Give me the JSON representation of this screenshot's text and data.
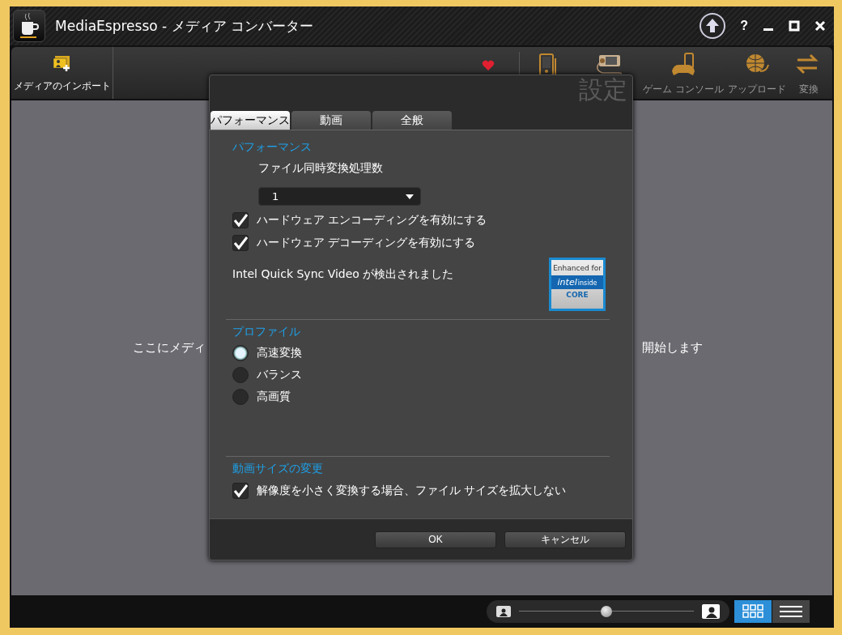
{
  "window": {
    "title": "MediaEspresso  - メディア コンバーター",
    "help": "?"
  },
  "toolbar": {
    "import_label": "メディアのインポート",
    "device_labels": [
      "ゲーム コンソール",
      "アップロード",
      "変換"
    ]
  },
  "drop_hint": {
    "left_part": "ここにメディ",
    "right_part": "開始します"
  },
  "dialog": {
    "title": "設定",
    "tabs": [
      {
        "label": "パフォーマンス",
        "selected": true
      },
      {
        "label": "動画",
        "selected": false
      },
      {
        "label": "全般",
        "selected": false
      }
    ],
    "performance": {
      "heading": "パフォーマンス",
      "count_label": "ファイル同時変換処理数",
      "count_value": "1",
      "options": [
        {
          "label": "ハードウェア エンコーディングを有効にする",
          "checked": true
        },
        {
          "label": "ハードウェア デコーディングを有効にする",
          "checked": true
        }
      ],
      "detected": "Intel Quick Sync Video が検出されました",
      "badge": {
        "top": "Enhanced for",
        "brand": "intel",
        "sub": "inside",
        "tier": "CORE"
      }
    },
    "profile": {
      "heading": "プロファイル",
      "choices": [
        {
          "label": "高速変換",
          "selected": true
        },
        {
          "label": "バランス",
          "selected": false
        },
        {
          "label": "高画質",
          "selected": false
        }
      ]
    },
    "resize": {
      "heading": "動画サイズの変更",
      "options": [
        {
          "label": "解像度を小さく変換する場合、ファイル サイズを拡大しない",
          "checked": true
        }
      ]
    },
    "buttons": [
      "OK",
      "キャンセル"
    ]
  },
  "status_bar": {
    "zoom": {
      "level": 0.5
    },
    "views": [
      {
        "selected": true
      },
      {
        "selected": false
      }
    ]
  }
}
